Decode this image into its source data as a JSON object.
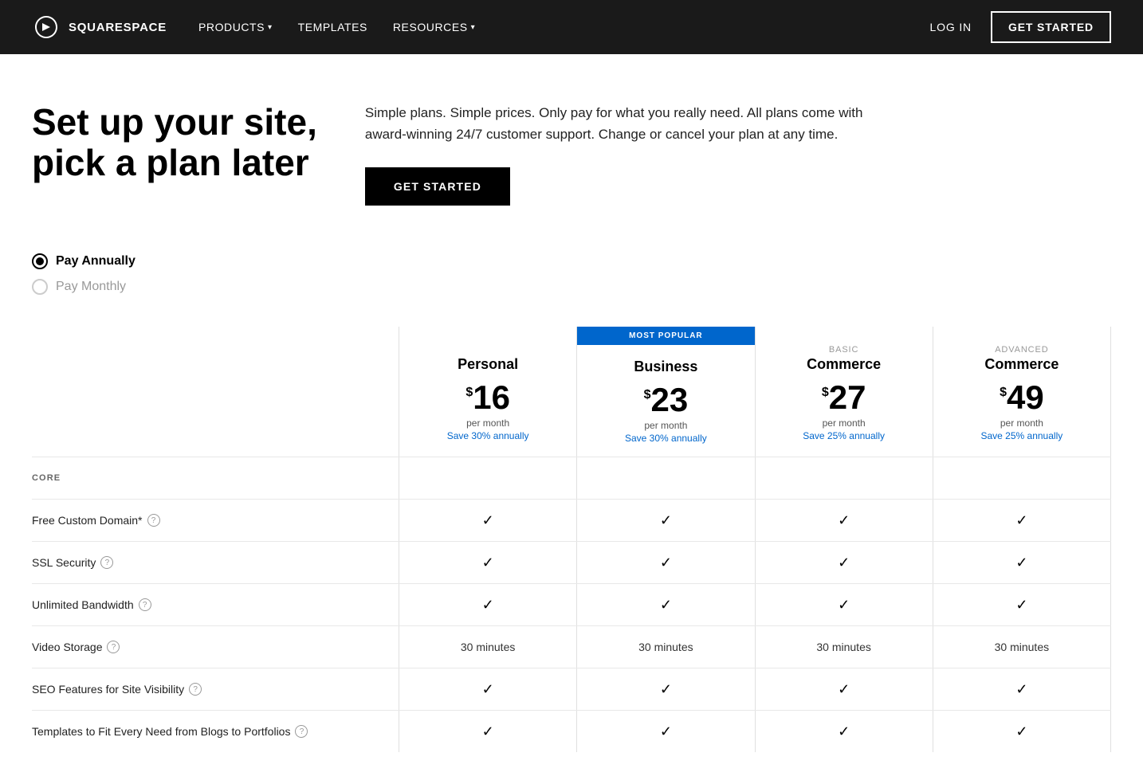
{
  "nav": {
    "logo_text": "SQUARESPACE",
    "links": [
      {
        "label": "PRODUCTS",
        "has_dropdown": true
      },
      {
        "label": "TEMPLATES",
        "has_dropdown": false
      },
      {
        "label": "RESOURCES",
        "has_dropdown": true
      }
    ],
    "login_label": "LOG IN",
    "get_started_label": "GET STARTED"
  },
  "hero": {
    "title_line1": "Set up your site,",
    "title_line2": "pick a plan later",
    "description": "Simple plans. Simple prices. Only pay for what you really need. All plans come with award-winning 24/7 customer support. Change or cancel your plan at any time.",
    "cta_label": "GET STARTED"
  },
  "billing": {
    "pay_annually_label": "Pay Annually",
    "pay_monthly_label": "Pay Monthly",
    "annually_selected": true
  },
  "plans": [
    {
      "id": "personal",
      "tier": "",
      "name": "Personal",
      "dollar": "$",
      "amount": "16",
      "period": "per month",
      "savings": "Save 30% annually",
      "most_popular": false
    },
    {
      "id": "business",
      "tier": "",
      "name": "Business",
      "dollar": "$",
      "amount": "23",
      "period": "per month",
      "savings": "Save 30% annually",
      "most_popular": true,
      "most_popular_label": "MOST POPULAR"
    },
    {
      "id": "commerce-basic",
      "tier": "BASIC",
      "name": "Commerce",
      "dollar": "$",
      "amount": "27",
      "period": "per month",
      "savings": "Save 25% annually",
      "most_popular": false
    },
    {
      "id": "commerce-advanced",
      "tier": "ADVANCED",
      "name": "Commerce",
      "dollar": "$",
      "amount": "49",
      "period": "per month",
      "savings": "Save 25% annually",
      "most_popular": false
    }
  ],
  "sections": [
    {
      "label": "CORE",
      "features": [
        {
          "name": "Free Custom Domain*",
          "has_help": true,
          "values": [
            "check",
            "check",
            "check",
            "check"
          ]
        },
        {
          "name": "SSL Security",
          "has_help": true,
          "values": [
            "check",
            "check",
            "check",
            "check"
          ]
        },
        {
          "name": "Unlimited Bandwidth",
          "has_help": true,
          "values": [
            "check",
            "check",
            "check",
            "check"
          ]
        },
        {
          "name": "Video Storage",
          "has_help": true,
          "values": [
            "30 minutes",
            "30 minutes",
            "30 minutes",
            "30 minutes"
          ]
        },
        {
          "name": "SEO Features for Site Visibility",
          "has_help": true,
          "values": [
            "check",
            "check",
            "check",
            "check"
          ]
        },
        {
          "name": "Templates to Fit Every Need from Blogs to Portfolios",
          "has_help": true,
          "values": [
            "check",
            "check",
            "check",
            "check"
          ]
        }
      ]
    }
  ]
}
